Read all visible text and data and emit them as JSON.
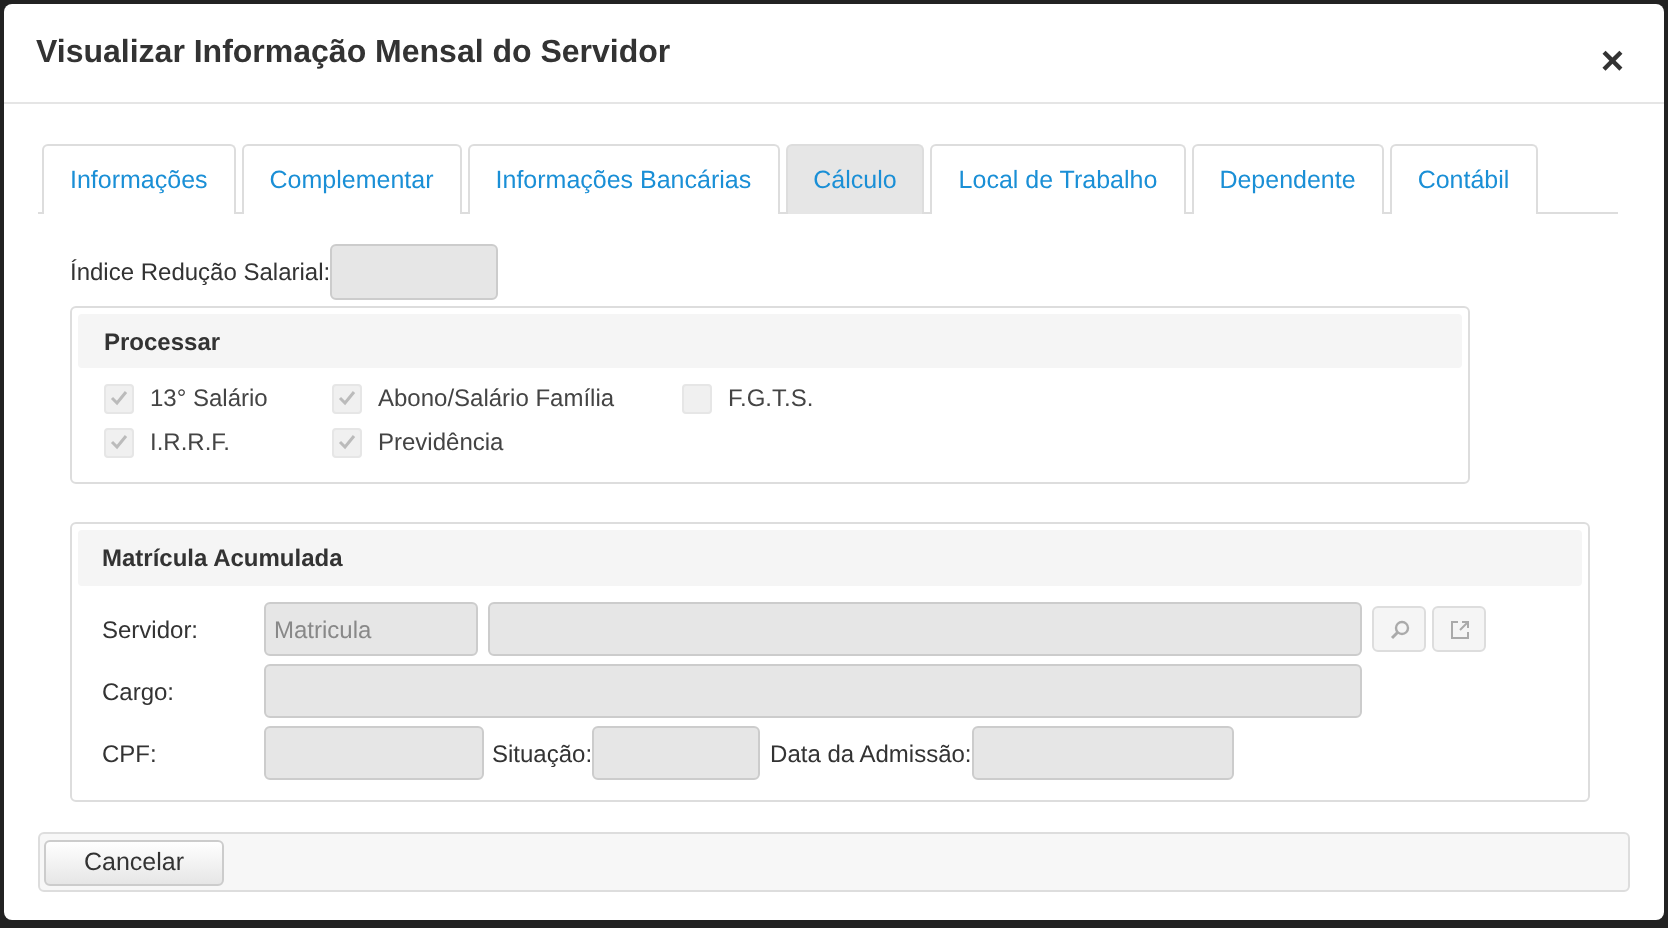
{
  "window": {
    "title": "Visualizar Informação Mensal do Servidor",
    "close": "×"
  },
  "tabs": [
    {
      "label": "Informações",
      "selected": false
    },
    {
      "label": "Complementar",
      "selected": false
    },
    {
      "label": "Informações Bancárias",
      "selected": false
    },
    {
      "label": "Cálculo",
      "selected": true
    },
    {
      "label": "Local de Trabalho",
      "selected": false
    },
    {
      "label": "Dependente",
      "selected": false
    },
    {
      "label": "Contábil",
      "selected": false
    }
  ],
  "indice": {
    "label": "Índice Redução Salarial:"
  },
  "processar": {
    "title": "Processar",
    "options": [
      {
        "label": "13° Salário",
        "checked": true,
        "disabled": true
      },
      {
        "label": "Abono/Salário Família",
        "checked": true,
        "disabled": true
      },
      {
        "label": "F.G.T.S.",
        "checked": false,
        "disabled": true
      },
      {
        "label": "I.R.R.F.",
        "checked": true,
        "disabled": true
      },
      {
        "label": "Previdência",
        "checked": true,
        "disabled": true
      }
    ]
  },
  "matricula": {
    "title": "Matrícula Acumulada",
    "servidor_label": "Servidor:",
    "matricula_placeholder": "Matricula",
    "cargo_label": "Cargo:",
    "cpf_label": "CPF:",
    "situacao_label": "Situação:",
    "admissao_label": "Data da Admissão:"
  },
  "buttons": [
    "Cancelar"
  ]
}
